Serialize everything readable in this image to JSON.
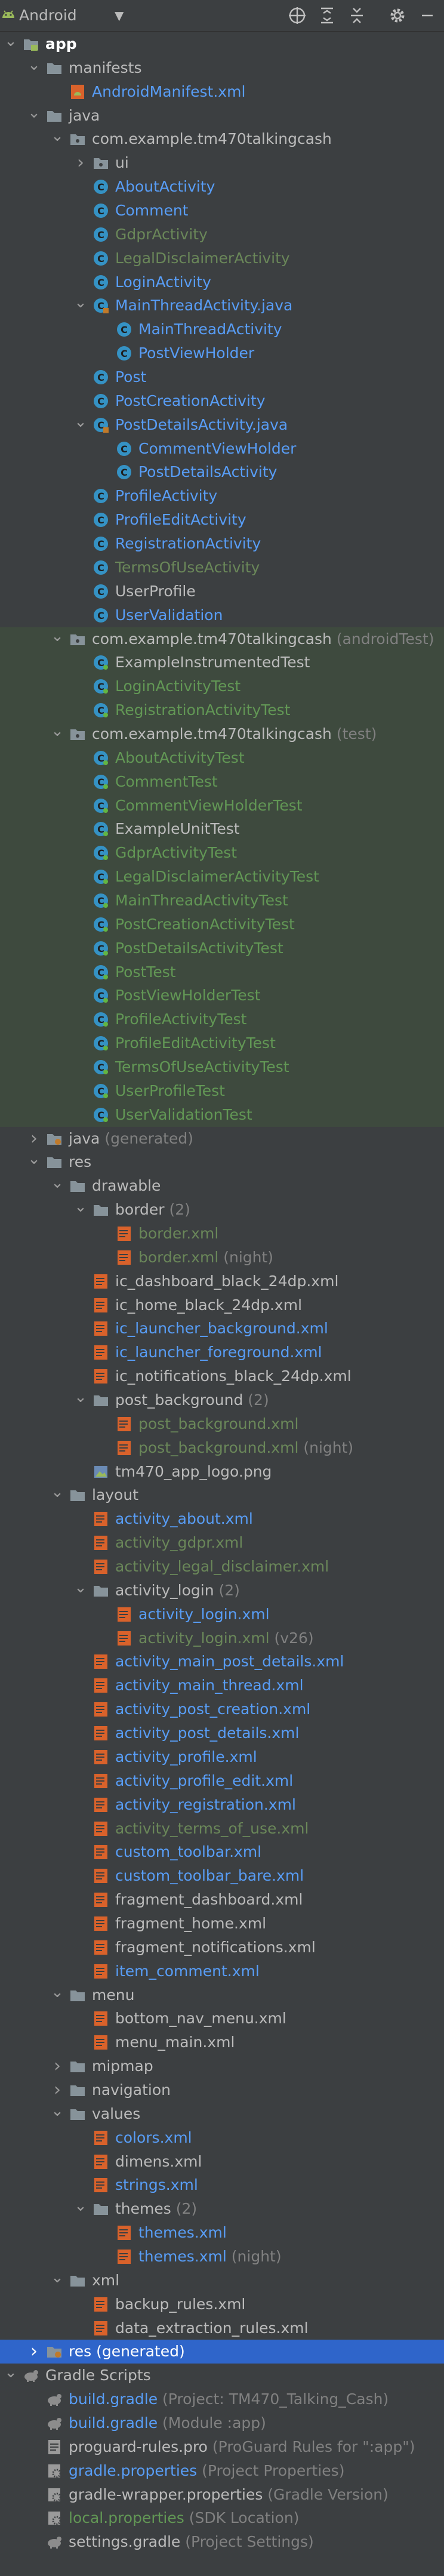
{
  "toolbar": {
    "view": "Android"
  },
  "colors": {
    "text": "#bbbbbb",
    "green": "#6a8759",
    "blue": "#589df6",
    "gray": "#808080",
    "classIcon": "#3592c4",
    "xmlIcon": "#d9622b",
    "selection": "#2f65ca"
  },
  "tree": [
    {
      "depth": 0,
      "arrow": "down",
      "icon": "android-module",
      "name": "app",
      "bold": true
    },
    {
      "depth": 1,
      "arrow": "down",
      "icon": "folder",
      "name": "manifests"
    },
    {
      "depth": 2,
      "icon": "android-manifest",
      "name": "AndroidManifest.xml",
      "color": "blue"
    },
    {
      "depth": 1,
      "arrow": "down",
      "icon": "folder",
      "name": "java"
    },
    {
      "depth": 2,
      "arrow": "down",
      "icon": "package",
      "name": "com.example.tm470talkingcash"
    },
    {
      "depth": 3,
      "arrow": "right",
      "icon": "package",
      "name": "ui"
    },
    {
      "depth": 3,
      "icon": "class",
      "name": "AboutActivity",
      "color": "blue"
    },
    {
      "depth": 3,
      "icon": "class",
      "name": "Comment",
      "color": "blue"
    },
    {
      "depth": 3,
      "icon": "class",
      "name": "GdprActivity",
      "color": "green"
    },
    {
      "depth": 3,
      "icon": "class",
      "name": "LegalDisclaimerActivity",
      "color": "green"
    },
    {
      "depth": 3,
      "icon": "class",
      "name": "LoginActivity",
      "color": "blue"
    },
    {
      "depth": 3,
      "arrow": "down",
      "icon": "java-file",
      "name": "MainThreadActivity.java",
      "color": "blue"
    },
    {
      "depth": 4,
      "icon": "class",
      "name": "MainThreadActivity",
      "color": "blue"
    },
    {
      "depth": 4,
      "icon": "class",
      "name": "PostViewHolder",
      "color": "blue"
    },
    {
      "depth": 3,
      "icon": "class",
      "name": "Post",
      "color": "blue"
    },
    {
      "depth": 3,
      "icon": "class",
      "name": "PostCreationActivity",
      "color": "blue"
    },
    {
      "depth": 3,
      "arrow": "down",
      "icon": "java-file",
      "name": "PostDetailsActivity.java",
      "color": "blue"
    },
    {
      "depth": 4,
      "icon": "class",
      "name": "CommentViewHolder",
      "color": "blue"
    },
    {
      "depth": 4,
      "icon": "class",
      "name": "PostDetailsActivity",
      "color": "blue"
    },
    {
      "depth": 3,
      "icon": "class",
      "name": "ProfileActivity",
      "color": "blue"
    },
    {
      "depth": 3,
      "icon": "class",
      "name": "ProfileEditActivity",
      "color": "blue"
    },
    {
      "depth": 3,
      "icon": "class",
      "name": "RegistrationActivity",
      "color": "blue"
    },
    {
      "depth": 3,
      "icon": "class",
      "name": "TermsOfUseActivity",
      "color": "green"
    },
    {
      "depth": 3,
      "icon": "class",
      "name": "UserProfile",
      "color": "text"
    },
    {
      "depth": 3,
      "icon": "class",
      "name": "UserValidation",
      "color": "blue"
    },
    {
      "depth": 2,
      "arrow": "down",
      "icon": "package",
      "name": "com.example.tm470talkingcash",
      "suffix": "(androidTest)",
      "hl": "green"
    },
    {
      "depth": 3,
      "icon": "test-class",
      "name": "ExampleInstrumentedTest",
      "color": "text",
      "hl": "green"
    },
    {
      "depth": 3,
      "icon": "test-class",
      "name": "LoginActivityTest",
      "color": "gtest",
      "hl": "green"
    },
    {
      "depth": 3,
      "icon": "test-class",
      "name": "RegistrationActivityTest",
      "color": "gtest",
      "hl": "green"
    },
    {
      "depth": 2,
      "arrow": "down",
      "icon": "package",
      "name": "com.example.tm470talkingcash",
      "suffix": "(test)",
      "hl": "green"
    },
    {
      "depth": 3,
      "icon": "test-class",
      "name": "AboutActivityTest",
      "color": "gtest",
      "hl": "green"
    },
    {
      "depth": 3,
      "icon": "test-class",
      "name": "CommentTest",
      "color": "gtest",
      "hl": "green"
    },
    {
      "depth": 3,
      "icon": "test-class",
      "name": "CommentViewHolderTest",
      "color": "gtest",
      "hl": "green"
    },
    {
      "depth": 3,
      "icon": "test-class",
      "name": "ExampleUnitTest",
      "color": "text",
      "hl": "green"
    },
    {
      "depth": 3,
      "icon": "test-class",
      "name": "GdprActivityTest",
      "color": "gtest",
      "hl": "green"
    },
    {
      "depth": 3,
      "icon": "test-class",
      "name": "LegalDisclaimerActivityTest",
      "color": "gtest",
      "hl": "green"
    },
    {
      "depth": 3,
      "icon": "test-class",
      "name": "MainThreadActivityTest",
      "color": "gtest",
      "hl": "green"
    },
    {
      "depth": 3,
      "icon": "test-class",
      "name": "PostCreationActivityTest",
      "color": "gtest",
      "hl": "green"
    },
    {
      "depth": 3,
      "icon": "test-class",
      "name": "PostDetailsActivityTest",
      "color": "gtest",
      "hl": "green"
    },
    {
      "depth": 3,
      "icon": "test-class",
      "name": "PostTest",
      "color": "gtest",
      "hl": "green"
    },
    {
      "depth": 3,
      "icon": "test-class",
      "name": "PostViewHolderTest",
      "color": "gtest",
      "hl": "green"
    },
    {
      "depth": 3,
      "icon": "test-class",
      "name": "ProfileActivityTest",
      "color": "gtest",
      "hl": "green"
    },
    {
      "depth": 3,
      "icon": "test-class",
      "name": "ProfileEditActivityTest",
      "color": "gtest",
      "hl": "green"
    },
    {
      "depth": 3,
      "icon": "test-class",
      "name": "TermsOfUseActivityTest",
      "color": "gtest",
      "hl": "green"
    },
    {
      "depth": 3,
      "icon": "test-class",
      "name": "UserProfileTest",
      "color": "gtest",
      "hl": "green"
    },
    {
      "depth": 3,
      "icon": "test-class",
      "name": "UserValidationTest",
      "color": "gtest",
      "hl": "green"
    },
    {
      "depth": 1,
      "arrow": "right",
      "icon": "folder-gen",
      "name": "java",
      "suffix": "(generated)"
    },
    {
      "depth": 1,
      "arrow": "down",
      "icon": "folder",
      "name": "res"
    },
    {
      "depth": 2,
      "arrow": "down",
      "icon": "folder",
      "name": "drawable"
    },
    {
      "depth": 3,
      "arrow": "down",
      "icon": "folder",
      "name": "border",
      "suffix": "(2)"
    },
    {
      "depth": 4,
      "icon": "xml",
      "name": "border.xml",
      "color": "green"
    },
    {
      "depth": 4,
      "icon": "xml",
      "name": "border.xml",
      "suffix": "(night)",
      "color": "green"
    },
    {
      "depth": 3,
      "icon": "xml",
      "name": "ic_dashboard_black_24dp.xml",
      "color": "text"
    },
    {
      "depth": 3,
      "icon": "xml",
      "name": "ic_home_black_24dp.xml",
      "color": "text"
    },
    {
      "depth": 3,
      "icon": "xml",
      "name": "ic_launcher_background.xml",
      "color": "blue"
    },
    {
      "depth": 3,
      "icon": "xml",
      "name": "ic_launcher_foreground.xml",
      "color": "blue"
    },
    {
      "depth": 3,
      "icon": "xml",
      "name": "ic_notifications_black_24dp.xml",
      "color": "text"
    },
    {
      "depth": 3,
      "arrow": "down",
      "icon": "folder",
      "name": "post_background",
      "suffix": "(2)"
    },
    {
      "depth": 4,
      "icon": "xml",
      "name": "post_background.xml",
      "color": "green"
    },
    {
      "depth": 4,
      "icon": "xml",
      "name": "post_background.xml",
      "suffix": "(night)",
      "color": "green"
    },
    {
      "depth": 3,
      "icon": "image",
      "name": "tm470_app_logo.png",
      "color": "text"
    },
    {
      "depth": 2,
      "arrow": "down",
      "icon": "folder",
      "name": "layout"
    },
    {
      "depth": 3,
      "icon": "xml",
      "name": "activity_about.xml",
      "color": "blue"
    },
    {
      "depth": 3,
      "icon": "xml",
      "name": "activity_gdpr.xml",
      "color": "green"
    },
    {
      "depth": 3,
      "icon": "xml",
      "name": "activity_legal_disclaimer.xml",
      "color": "green"
    },
    {
      "depth": 3,
      "arrow": "down",
      "icon": "folder",
      "name": "activity_login",
      "suffix": "(2)"
    },
    {
      "depth": 4,
      "icon": "xml",
      "name": "activity_login.xml",
      "color": "blue"
    },
    {
      "depth": 4,
      "icon": "xml",
      "name": "activity_login.xml",
      "suffix": "(v26)",
      "color": "green"
    },
    {
      "depth": 3,
      "icon": "xml",
      "name": "activity_main_post_details.xml",
      "color": "blue"
    },
    {
      "depth": 3,
      "icon": "xml",
      "name": "activity_main_thread.xml",
      "color": "blue"
    },
    {
      "depth": 3,
      "icon": "xml",
      "name": "activity_post_creation.xml",
      "color": "blue"
    },
    {
      "depth": 3,
      "icon": "xml",
      "name": "activity_post_details.xml",
      "color": "blue"
    },
    {
      "depth": 3,
      "icon": "xml",
      "name": "activity_profile.xml",
      "color": "blue"
    },
    {
      "depth": 3,
      "icon": "xml",
      "name": "activity_profile_edit.xml",
      "color": "blue"
    },
    {
      "depth": 3,
      "icon": "xml",
      "name": "activity_registration.xml",
      "color": "blue"
    },
    {
      "depth": 3,
      "icon": "xml",
      "name": "activity_terms_of_use.xml",
      "color": "green"
    },
    {
      "depth": 3,
      "icon": "xml",
      "name": "custom_toolbar.xml",
      "color": "blue"
    },
    {
      "depth": 3,
      "icon": "xml",
      "name": "custom_toolbar_bare.xml",
      "color": "blue"
    },
    {
      "depth": 3,
      "icon": "xml",
      "name": "fragment_dashboard.xml",
      "color": "text"
    },
    {
      "depth": 3,
      "icon": "xml",
      "name": "fragment_home.xml",
      "color": "text"
    },
    {
      "depth": 3,
      "icon": "xml",
      "name": "fragment_notifications.xml",
      "color": "text"
    },
    {
      "depth": 3,
      "icon": "xml",
      "name": "item_comment.xml",
      "color": "blue"
    },
    {
      "depth": 2,
      "arrow": "down",
      "icon": "folder",
      "name": "menu"
    },
    {
      "depth": 3,
      "icon": "xml",
      "name": "bottom_nav_menu.xml",
      "color": "text"
    },
    {
      "depth": 3,
      "icon": "xml",
      "name": "menu_main.xml",
      "color": "text"
    },
    {
      "depth": 2,
      "arrow": "right",
      "icon": "folder",
      "name": "mipmap"
    },
    {
      "depth": 2,
      "arrow": "right",
      "icon": "folder",
      "name": "navigation"
    },
    {
      "depth": 2,
      "arrow": "down",
      "icon": "folder",
      "name": "values"
    },
    {
      "depth": 3,
      "icon": "xml",
      "name": "colors.xml",
      "color": "blue"
    },
    {
      "depth": 3,
      "icon": "xml",
      "name": "dimens.xml",
      "color": "text"
    },
    {
      "depth": 3,
      "icon": "xml",
      "name": "strings.xml",
      "color": "blue"
    },
    {
      "depth": 3,
      "arrow": "down",
      "icon": "folder",
      "name": "themes",
      "suffix": "(2)"
    },
    {
      "depth": 4,
      "icon": "xml",
      "name": "themes.xml",
      "color": "blue"
    },
    {
      "depth": 4,
      "icon": "xml",
      "name": "themes.xml",
      "suffix": "(night)",
      "color": "blue"
    },
    {
      "depth": 2,
      "arrow": "down",
      "icon": "folder",
      "name": "xml"
    },
    {
      "depth": 3,
      "icon": "xml",
      "name": "backup_rules.xml",
      "color": "text"
    },
    {
      "depth": 3,
      "icon": "xml",
      "name": "data_extraction_rules.xml",
      "color": "text"
    },
    {
      "depth": 1,
      "arrow": "right",
      "icon": "folder-gen",
      "name": "res",
      "suffix": "(generated)",
      "hl": "blue",
      "color": "white"
    },
    {
      "depth": 0,
      "arrow": "down",
      "icon": "gradle",
      "name": "Gradle Scripts"
    },
    {
      "depth": 1,
      "icon": "gradle",
      "name": "build.gradle",
      "suffix": "(Project: TM470_Talking_Cash)",
      "color": "blue"
    },
    {
      "depth": 1,
      "icon": "gradle",
      "name": "build.gradle",
      "suffix": "(Module :app)",
      "color": "blue"
    },
    {
      "depth": 1,
      "icon": "text-file",
      "name": "proguard-rules.pro",
      "suffix": "(ProGuard Rules for \":app\")",
      "color": "text"
    },
    {
      "depth": 1,
      "icon": "properties",
      "name": "gradle.properties",
      "suffix": "(Project Properties)",
      "color": "blue"
    },
    {
      "depth": 1,
      "icon": "properties",
      "name": "gradle-wrapper.properties",
      "suffix": "(Gradle Version)",
      "color": "text"
    },
    {
      "depth": 1,
      "icon": "properties",
      "name": "local.properties",
      "suffix": "(SDK Location)",
      "color": "gray2"
    },
    {
      "depth": 1,
      "icon": "gradle",
      "name": "settings.gradle",
      "suffix": "(Project Settings)",
      "color": "text"
    }
  ]
}
